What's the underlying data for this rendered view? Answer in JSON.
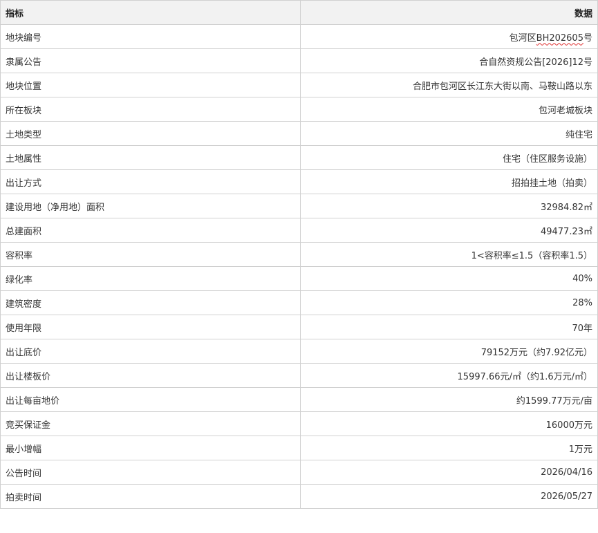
{
  "table": {
    "headers": [
      "指标",
      "数据"
    ],
    "rows": [
      {
        "label": "地块编号",
        "value_prefix": "包河区",
        "value_marked": "BH202605",
        "value_suffix": "号"
      },
      {
        "label": "隶属公告",
        "value": "合自然资规公告[2026]12号"
      },
      {
        "label": "地块位置",
        "value": "合肥市包河区长江东大街以南、马鞍山路以东"
      },
      {
        "label": "所在板块",
        "value": "包河老城板块"
      },
      {
        "label": "土地类型",
        "value": "纯住宅"
      },
      {
        "label": "土地属性",
        "value": "住宅（住区服务设施）"
      },
      {
        "label": "出让方式",
        "value": "招拍挂土地（拍卖）"
      },
      {
        "label": "建设用地（净用地）面积",
        "value": "32984.82㎡"
      },
      {
        "label": "总建面积",
        "value": "49477.23㎡"
      },
      {
        "label": "容积率",
        "value": "1<容积率≤1.5（容积率1.5）"
      },
      {
        "label": "绿化率",
        "value": "40%"
      },
      {
        "label": "建筑密度",
        "value": "28%"
      },
      {
        "label": "使用年限",
        "value": "70年"
      },
      {
        "label": "出让底价",
        "value": "79152万元（约7.92亿元）"
      },
      {
        "label": "出让楼板价",
        "value": "15997.66元/㎡（约1.6万元/㎡）"
      },
      {
        "label": "出让每亩地价",
        "value": "约1599.77万元/亩"
      },
      {
        "label": "竞买保证金",
        "value": "16000万元"
      },
      {
        "label": "最小增幅",
        "value": "1万元"
      },
      {
        "label": "公告时间",
        "value": "2026/04/16"
      },
      {
        "label": "拍卖时间",
        "value": "2026/05/27"
      }
    ]
  }
}
